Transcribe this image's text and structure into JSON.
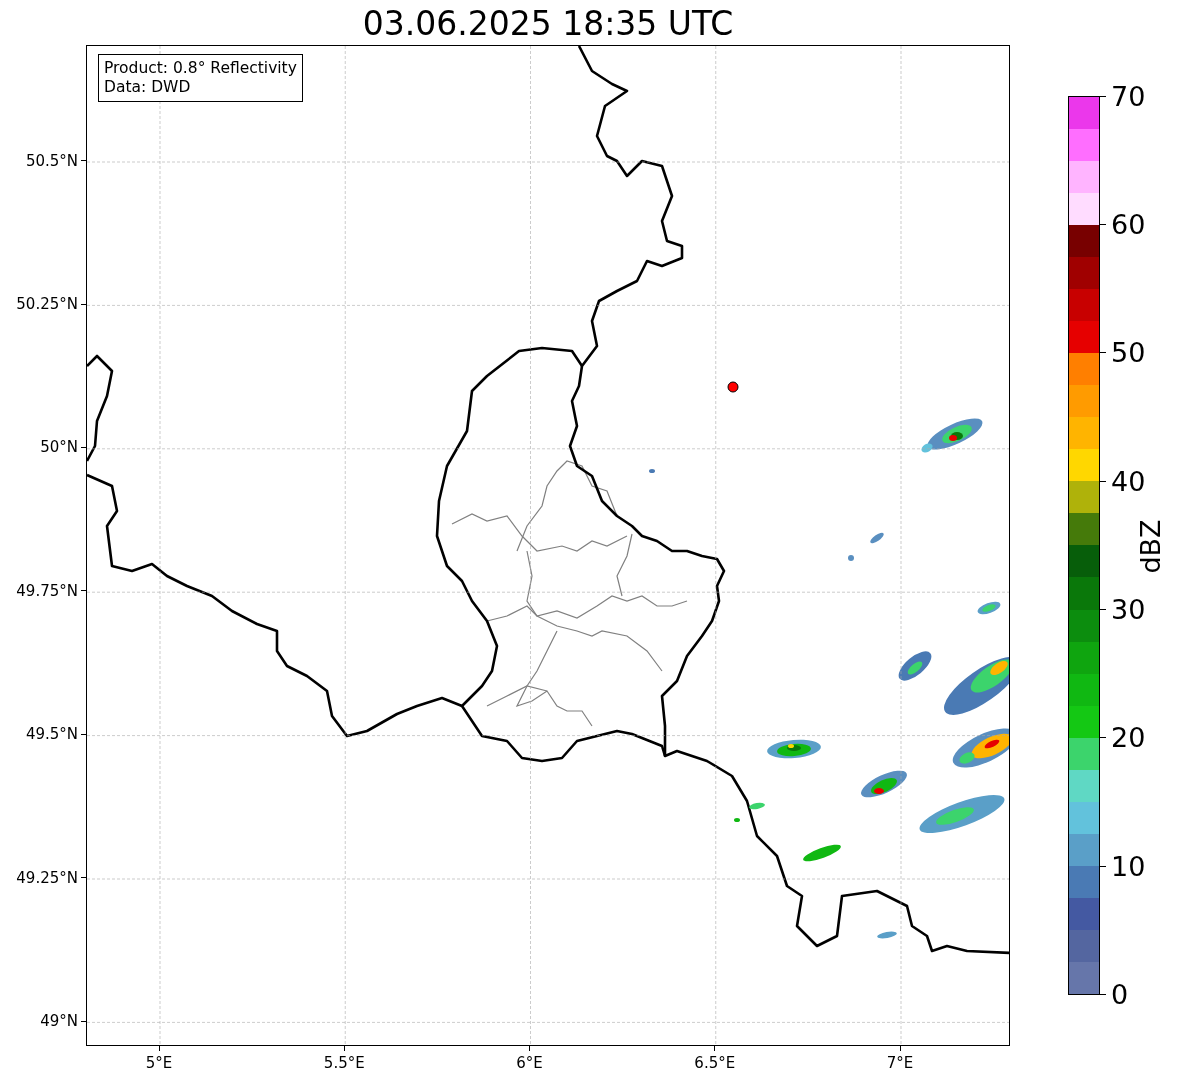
{
  "title": "03.06.2025 18:35 UTC",
  "info_box": [
    "Product: 0.8° Reflectivity",
    "Data: DWD"
  ],
  "x_axis": {
    "ticks": [
      "5°E",
      "5.5°E",
      "6°E",
      "6.5°E",
      "7°E"
    ]
  },
  "y_axis": {
    "ticks": [
      "50.5°N",
      "50.25°N",
      "50°N",
      "49.75°N",
      "49.5°N",
      "49.25°N",
      "49°N"
    ]
  },
  "colorbar": {
    "label": "dBZ",
    "ticks": [
      "70",
      "60",
      "50",
      "40",
      "30",
      "20",
      "10",
      "0"
    ],
    "segments": [
      {
        "color": "#eb37eb"
      },
      {
        "color": "#ff6eff"
      },
      {
        "color": "#ffb4ff"
      },
      {
        "color": "#ffdcff"
      },
      {
        "color": "#780000"
      },
      {
        "color": "#a00000"
      },
      {
        "color": "#c80000"
      },
      {
        "color": "#e60000"
      },
      {
        "color": "#ff7f00"
      },
      {
        "color": "#ff9b00"
      },
      {
        "color": "#ffb400"
      },
      {
        "color": "#ffd700"
      },
      {
        "color": "#afb20a"
      },
      {
        "color": "#457a0a"
      },
      {
        "color": "#075e0a"
      },
      {
        "color": "#0a780a"
      },
      {
        "color": "#0c8d0e"
      },
      {
        "color": "#0fa50f"
      },
      {
        "color": "#10b812"
      },
      {
        "color": "#14c814"
      },
      {
        "color": "#3cd46c"
      },
      {
        "color": "#5fd8c4"
      },
      {
        "color": "#62c2dc"
      },
      {
        "color": "#5a9fc8"
      },
      {
        "color": "#4a7ab4"
      },
      {
        "color": "#4459a2"
      },
      {
        "color": "#5466a0"
      },
      {
        "color": "#6676aa"
      }
    ]
  }
}
